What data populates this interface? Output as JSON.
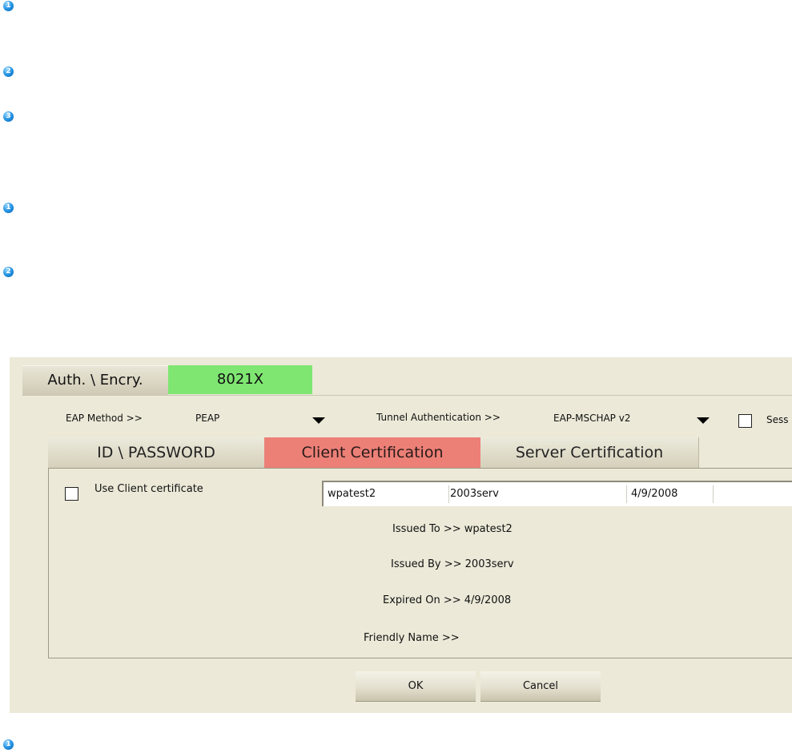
{
  "bullets": [
    "1",
    "2",
    "3",
    "1",
    "2",
    "1"
  ],
  "top_tabs": {
    "auth": "Auth. \\ Encry.",
    "x8021": "8021X"
  },
  "eap": {
    "method_label": "EAP Method >>",
    "method_value": "PEAP",
    "tunnel_label": "Tunnel Authentication >>",
    "tunnel_value": "EAP-MSCHAP v2",
    "session_label": "Sess"
  },
  "sub_tabs": {
    "id_password": "ID \\ PASSWORD",
    "client_cert": "Client Certification",
    "server_cert": "Server Certification"
  },
  "client": {
    "use_cert_label": "Use Client certificate",
    "cert_row": [
      "wpatest2",
      "2003serv",
      "4/9/2008"
    ],
    "issued_to": "Issued To >> wpatest2",
    "issued_by": "Issued By >> 2003serv",
    "expired_on": "Expired On >> 4/9/2008",
    "friendly_name": "Friendly Name >>"
  },
  "buttons": {
    "ok": "OK",
    "cancel": "Cancel"
  },
  "colors": {
    "panel_bg": "#ece9d8",
    "tab_active_green": "#7fe672",
    "tab_active_red": "#ec8077",
    "bullet_blue": "#1f8fe0"
  }
}
